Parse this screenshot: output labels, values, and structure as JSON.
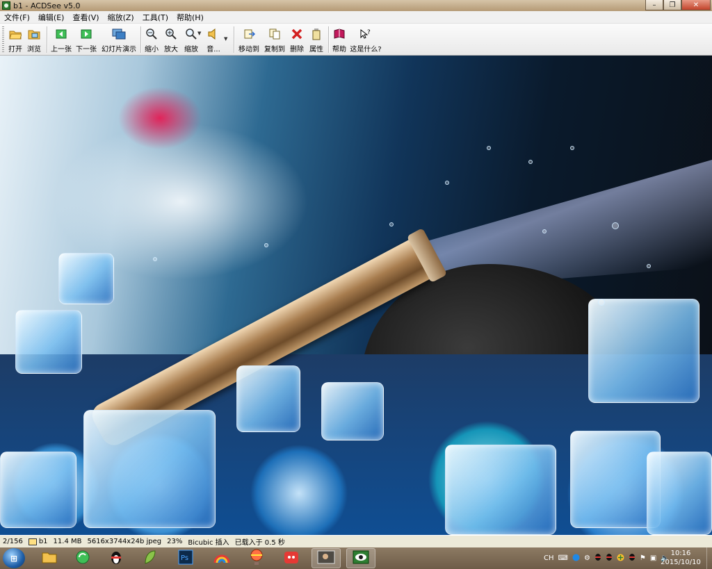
{
  "window": {
    "title": "b1 - ACDSee v5.0",
    "minimize": "–",
    "maximize": "❐",
    "close": "✕"
  },
  "menu": [
    "文件(F)",
    "编辑(E)",
    "查看(V)",
    "缩放(Z)",
    "工具(T)",
    "帮助(H)"
  ],
  "toolbar": {
    "open": "打开",
    "browse": "浏览",
    "prev": "上一张",
    "next": "下一张",
    "slideshow": "幻灯片演示",
    "zoom_out": "缩小",
    "zoom_in": "放大",
    "zoom": "缩放",
    "sound": "音...",
    "move_to": "移动到",
    "copy_to": "复制到",
    "delete": "删除",
    "properties": "属性",
    "help": "帮助",
    "whats_this": "这是什么?"
  },
  "status": {
    "position": "2/156",
    "filename": "b1",
    "filesize": "11.4 MB",
    "dimensions": "5616x3744x24b jpeg",
    "zoom": "23%",
    "resample": "Bicubic 插入",
    "load_time": "已载入于 0.5 秒"
  },
  "taskbar": {
    "start": "⊞",
    "tray": {
      "lang": "CH",
      "time": "10:16",
      "date": "2015/10/10"
    }
  },
  "icons": {
    "open": "folder-open-icon",
    "browse": "browse-icon",
    "prev": "arrow-left-icon",
    "next": "arrow-right-icon",
    "slideshow": "slideshow-icon",
    "zoom_out": "zoom-out-icon",
    "zoom_in": "zoom-in-icon",
    "zoom": "zoom-icon",
    "sound": "speaker-icon",
    "move_to": "move-icon",
    "copy_to": "copy-icon",
    "delete": "delete-icon",
    "properties": "properties-icon",
    "help": "help-book-icon",
    "whats_this": "whats-this-icon"
  }
}
